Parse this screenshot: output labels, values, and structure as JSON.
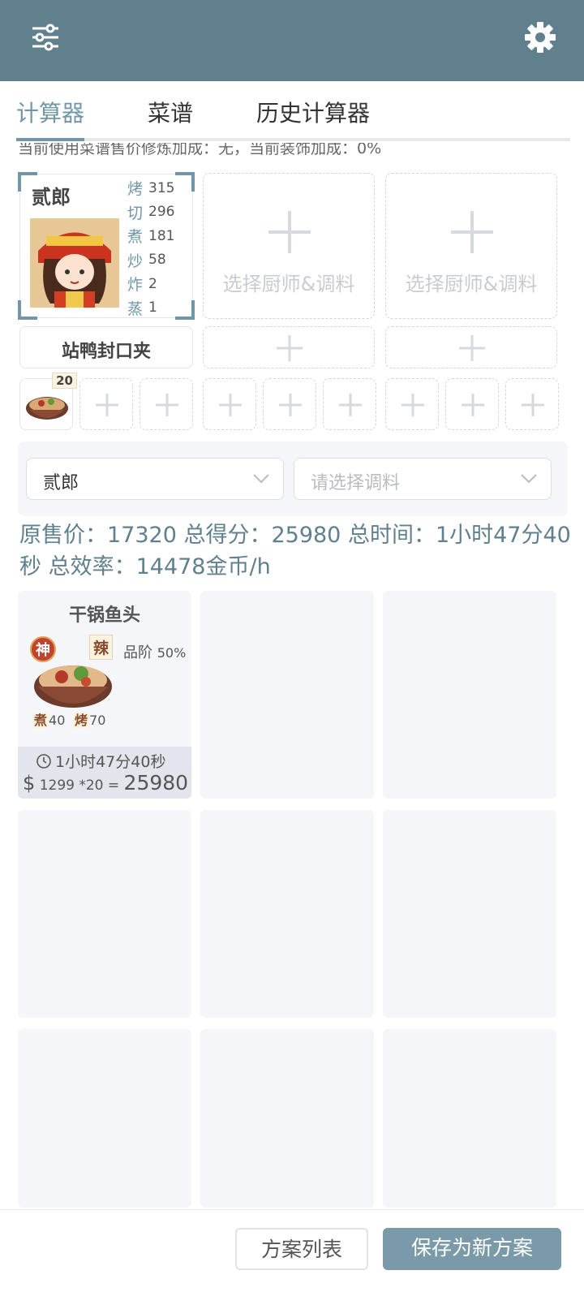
{
  "tabs": [
    "计算器",
    "菜谱",
    "历史计算器"
  ],
  "notice": "当前使用菜谱售价修炼加成：无，当前装饰加成：0%",
  "chef": {
    "name": "贰郎",
    "skills": [
      {
        "k": "烤",
        "v": "315"
      },
      {
        "k": "切",
        "v": "296"
      },
      {
        "k": "煮",
        "v": "181"
      },
      {
        "k": "炒",
        "v": "58"
      },
      {
        "k": "炸",
        "v": "2"
      },
      {
        "k": "蒸",
        "v": "1"
      }
    ]
  },
  "empty_chef_label": "选择厨师&调料",
  "equip_label": "站鸭封口夹",
  "dish_slot_badge": "20",
  "chef_select": "贰郎",
  "condiment_placeholder": "请选择调料",
  "summary": "原售价：17320 总得分：25980 总时间：1小时47分40秒 总效率：14478金币/h",
  "dish": {
    "title": "干锅鱼头",
    "rank_badge": "神",
    "flavor": "辣",
    "grade_label": "品阶",
    "grade_pct": "50%",
    "req1_k": "煮",
    "req1_v": "40",
    "req2_k": "烤",
    "req2_v": "70",
    "time": "1小时47分40秒",
    "dollar": "$",
    "price_expr": "1299 *20 =",
    "total": "25980"
  },
  "buttons": {
    "list": "方案列表",
    "save": "保存为新方案"
  },
  "colors": {
    "header": "#60808e",
    "accent": "#7096a8",
    "primary_button": "#7a9aaa"
  },
  "icons": [
    "sliders-icon",
    "gear-icon",
    "plus-icon",
    "chevron-down-icon",
    "clock-icon"
  ]
}
